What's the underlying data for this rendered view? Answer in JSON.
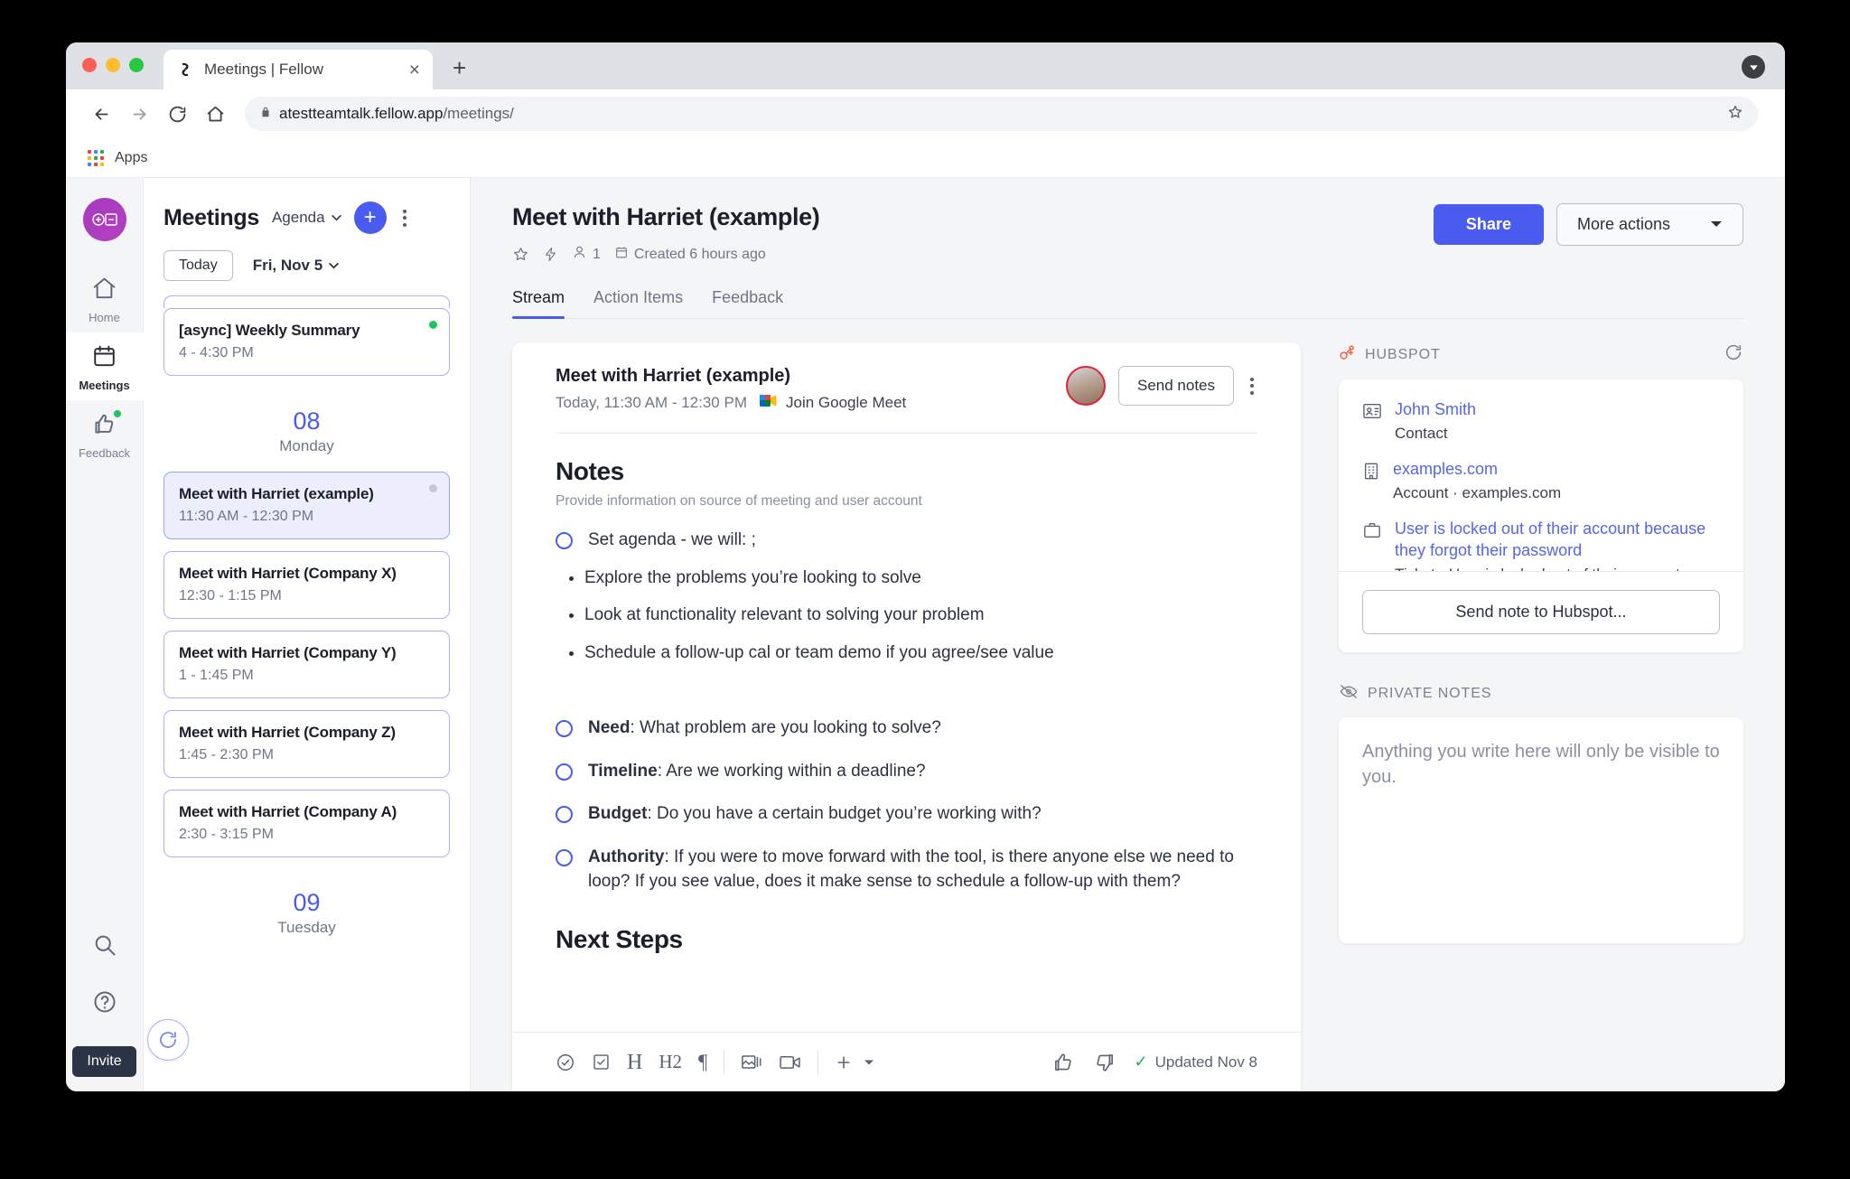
{
  "browser": {
    "tab_title": "Meetings | Fellow",
    "tab_favicon_icon": "fellow-logo-icon",
    "new_tab_label": "+",
    "close_label": "×",
    "url_host": "atestteamtalk.fellow.app",
    "url_path": "/meetings/",
    "lock_icon": "lock-icon",
    "back_icon": "back-arrow-icon",
    "forward_icon": "forward-arrow-icon",
    "reload_icon": "reload-icon",
    "home_icon": "home-icon",
    "star_icon": "bookmark-star-icon",
    "profile_icon": "profile-avatar-icon",
    "bookmark_apps_label": "Apps"
  },
  "rail": {
    "logo_icon": "fellow-workspace-logo",
    "items": [
      {
        "label": "Home",
        "icon": "home-icon",
        "active": false,
        "badge": false
      },
      {
        "label": "Meetings",
        "icon": "calendar-icon",
        "active": true,
        "badge": false
      },
      {
        "label": "Feedback",
        "icon": "thumbs-up-icon",
        "active": false,
        "badge": true
      }
    ],
    "search_icon": "search-icon",
    "help_icon": "help-circle-icon",
    "invite_label": "Invite"
  },
  "meetings_panel": {
    "title": "Meetings",
    "view_selector": "Agenda",
    "add_label": "+",
    "today_label": "Today",
    "date_label": "Fri, Nov 5",
    "refresh_icon": "refresh-icon",
    "groups": [
      {
        "day_number": "",
        "day_name": "",
        "clip_top": true,
        "items": [
          {
            "title": "[async] Weekly Summary",
            "time": "4 - 4:30 PM",
            "status": "green",
            "selected": false
          }
        ]
      },
      {
        "day_number": "08",
        "day_name": "Monday",
        "clip_top": false,
        "items": [
          {
            "title": "Meet with Harriet (example)",
            "time": "11:30 AM - 12:30 PM",
            "status": "grey",
            "selected": true
          },
          {
            "title": "Meet with Harriet (Company X)",
            "time": "12:30 - 1:15 PM",
            "status": "",
            "selected": false
          },
          {
            "title": "Meet with Harriet (Company Y)",
            "time": "1 - 1:45 PM",
            "status": "",
            "selected": false
          },
          {
            "title": "Meet with Harriet (Company Z)",
            "time": "1:45 - 2:30 PM",
            "status": "",
            "selected": false
          },
          {
            "title": "Meet with Harriet (Company A)",
            "time": "2:30 - 3:15 PM",
            "status": "",
            "selected": false
          }
        ]
      },
      {
        "day_number": "09",
        "day_name": "Tuesday",
        "clip_top": false,
        "items": []
      }
    ]
  },
  "header": {
    "title": "Meet with Harriet (example)",
    "star_icon": "star-outline-icon",
    "bolt_icon": "lightning-bolt-icon",
    "participants_icon": "person-icon",
    "participants_count": "1",
    "created_icon": "calendar-small-icon",
    "created_label": "Created 6 hours ago",
    "share_label": "Share",
    "more_actions_label": "More actions",
    "more_actions_caret": "▾",
    "tabs": [
      {
        "label": "Stream",
        "active": true
      },
      {
        "label": "Action Items",
        "active": false
      },
      {
        "label": "Feedback",
        "active": false
      }
    ]
  },
  "note_card": {
    "title": "Meet with Harriet (example)",
    "subtitle_time": "Today, 11:30 AM - 12:30 PM",
    "meet_icon": "google-meet-icon",
    "meet_link_label": "Join Google Meet",
    "avatar_icon": "user-avatar",
    "send_notes_label": "Send notes",
    "kebab_icon": "kebab-menu-icon",
    "notes_heading": "Notes",
    "notes_description": "Provide information on source of meeting and user account",
    "checklist_1": [
      {
        "prefix": "",
        "text": "Set agenda - we will: ;"
      }
    ],
    "bullets": [
      "Explore the problems you’re looking to solve",
      "Look at functionality relevant to solving your problem",
      "Schedule a follow-up cal or team demo if you agree/see value"
    ],
    "checklist_2": [
      {
        "prefix": "Need",
        "text": ": What problem are you looking to solve?"
      },
      {
        "prefix": "Timeline",
        "text": ": Are we working within a deadline?"
      },
      {
        "prefix": "Budget",
        "text": ": Do you have a certain budget you’re working with?"
      },
      {
        "prefix": "Authority",
        "text": ": If you were to move forward with the tool, is there anyone else we need to loop? If you see value, does it make sense to schedule a follow-up with them?"
      }
    ],
    "next_steps_heading": "Next Steps",
    "toolbar": {
      "icons": [
        "check-circle-icon",
        "checkbox-icon",
        "heading-h1-icon",
        "heading-h2-icon",
        "paragraph-icon",
        "image-icon",
        "video-icon",
        "plus-menu-icon"
      ],
      "thumbs_up_icon": "thumbs-up-icon",
      "thumbs_down_icon": "thumbs-down-icon",
      "updated_label": "Updated Nov 8",
      "updated_check_icon": "check-icon"
    }
  },
  "hubspot": {
    "section_label": "HUBSPOT",
    "logo_icon": "hubspot-logo-icon",
    "refresh_icon": "refresh-icon",
    "items": [
      {
        "icon": "contact-card-icon",
        "link": "John Smith",
        "sub": "Contact"
      },
      {
        "icon": "building-icon",
        "link": "examples.com",
        "sub": "Account · examples.com"
      },
      {
        "icon": "briefcase-icon",
        "link": "User is locked out of their account because they forgot their password",
        "sub": "Ticket · User is locked out of their account because they forgot their password"
      }
    ],
    "send_note_label": "Send note to Hubspot..."
  },
  "private_notes": {
    "section_label": "PRIVATE NOTES",
    "icon": "eye-off-icon",
    "placeholder": "Anything you write here will only be visible to you."
  }
}
